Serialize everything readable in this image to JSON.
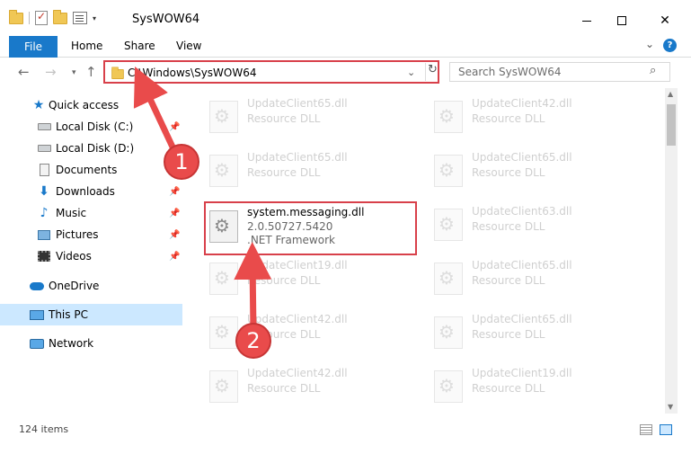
{
  "window": {
    "title": "SysWOW64",
    "controls": {
      "minimize": "",
      "maximize": "",
      "close": "✕"
    }
  },
  "ribbon": {
    "tabs": {
      "file": "File",
      "home": "Home",
      "share": "Share",
      "view": "View"
    },
    "help": "?"
  },
  "navigation": {
    "address": "C:\\Windows\\SysWOW64",
    "search_placeholder": "Search SysWOW64"
  },
  "sidebar": {
    "items": [
      {
        "label": "Quick access",
        "icon": "star-icon"
      },
      {
        "label": "Local Disk (C:)",
        "icon": "disk-icon",
        "pinned": true
      },
      {
        "label": "Local Disk (D:)",
        "icon": "disk-icon",
        "pinned": true
      },
      {
        "label": "Documents",
        "icon": "documents-icon",
        "pinned": true
      },
      {
        "label": "Downloads",
        "icon": "downloads-icon",
        "pinned": true
      },
      {
        "label": "Music",
        "icon": "music-icon",
        "pinned": true
      },
      {
        "label": "Pictures",
        "icon": "pictures-icon",
        "pinned": true
      },
      {
        "label": "Videos",
        "icon": "videos-icon",
        "pinned": true
      },
      {
        "label": "OneDrive",
        "icon": "onedrive-icon"
      },
      {
        "label": "This PC",
        "icon": "this-pc-icon",
        "selected": true
      },
      {
        "label": "Network",
        "icon": "network-icon"
      }
    ]
  },
  "files": {
    "left": [
      {
        "name": "UpdateClient65.dll",
        "type": "Resource DLL"
      },
      {
        "name": "UpdateClient65.dll",
        "type": "Resource DLL"
      },
      {
        "name": "system.messaging.dll",
        "version": "2.0.50727.5420",
        "type": ".NET Framework",
        "highlighted": true
      },
      {
        "name": "UpdateClient19.dll",
        "type": "Resource DLL"
      },
      {
        "name": "UpdateClient42.dll",
        "type": "Resource DLL"
      },
      {
        "name": "UpdateClient42.dll",
        "type": "Resource DLL"
      }
    ],
    "right": [
      {
        "name": "UpdateClient42.dll",
        "type": "Resource DLL"
      },
      {
        "name": "UpdateClient65.dll",
        "type": "Resource DLL"
      },
      {
        "name": "UpdateClient63.dll",
        "type": "Resource DLL"
      },
      {
        "name": "UpdateClient65.dll",
        "type": "Resource DLL"
      },
      {
        "name": "UpdateClient65.dll",
        "type": "Resource DLL"
      },
      {
        "name": "UpdateClient19.dll",
        "type": "Resource DLL"
      }
    ]
  },
  "status": {
    "items_count": "124 items"
  },
  "annotations": {
    "step1": "1",
    "step2": "2",
    "color": "#e94b4b"
  }
}
